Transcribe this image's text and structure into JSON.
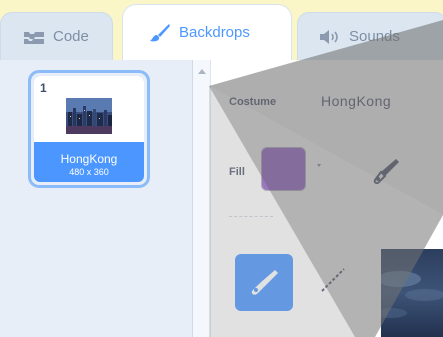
{
  "tabs": {
    "code": {
      "label": "Code",
      "icon": "code-blocks-icon"
    },
    "backdrops": {
      "label": "Backdrops",
      "icon": "paintbrush-icon",
      "selected": true
    },
    "sounds": {
      "label": "Sounds",
      "icon": "speaker-icon"
    }
  },
  "backdrop_list": {
    "items": [
      {
        "index": "1",
        "name": "HongKong",
        "size": "480 x 360",
        "selected": true,
        "thumbnail": "city-night-skyline"
      }
    ]
  },
  "editor": {
    "costume_label": "Costume",
    "costume_name": "HongKong",
    "fill_label": "Fill",
    "fill_color": "#9966CC",
    "tools": [
      "eyedropper-icon",
      "brush-icon",
      "line-icon"
    ]
  },
  "colors": {
    "accent": "#4C97FF",
    "selection_border": "#8BBCF9",
    "tab_background": "#DBE6F1",
    "page_background": "#FBF6C8"
  }
}
